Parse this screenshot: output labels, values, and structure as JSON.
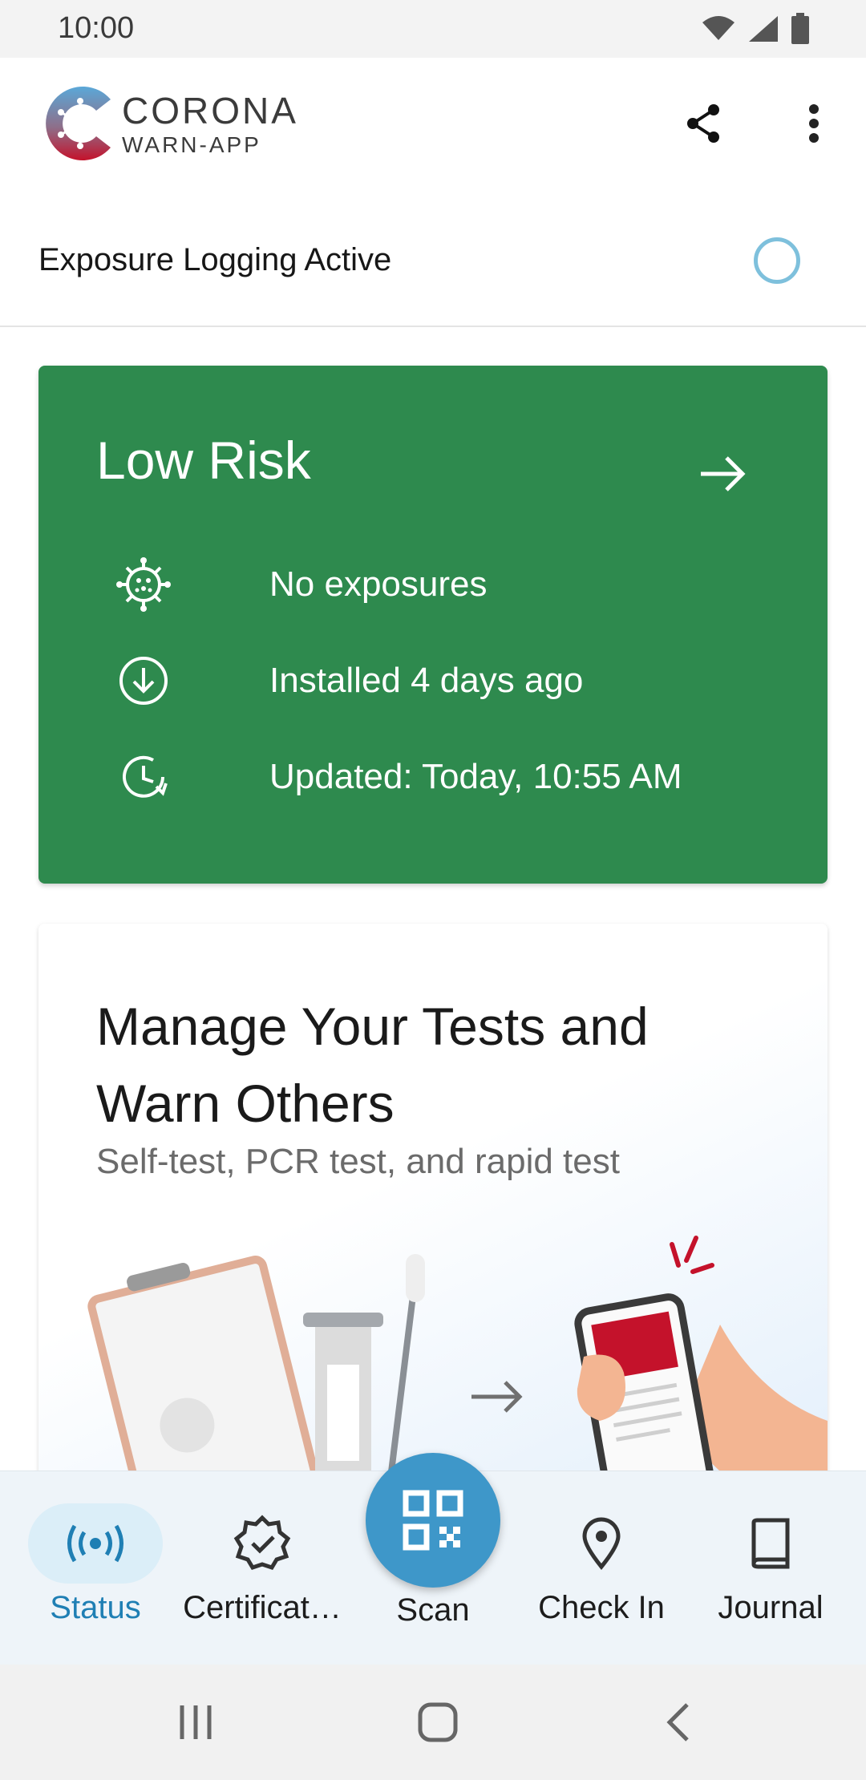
{
  "status_bar": {
    "time": "10:00"
  },
  "app": {
    "name_line1": "CORONA",
    "name_line2": "WARN-APP"
  },
  "exposure": {
    "label": "Exposure Logging Active"
  },
  "risk_card": {
    "title": "Low Risk",
    "rows": [
      {
        "icon": "virus-icon",
        "text": "No exposures"
      },
      {
        "icon": "download-icon",
        "text": "Installed 4 days ago"
      },
      {
        "icon": "refresh-clock-icon",
        "text": "Updated: Today, 10:55 AM"
      }
    ],
    "color": "#2e8a4e"
  },
  "tests_card": {
    "title": "Manage Your Tests and Warn Others",
    "subtitle": "Self-test, PCR test, and rapid test"
  },
  "bottom_nav": {
    "items": [
      {
        "label": "Status",
        "icon": "broadcast-icon",
        "active": true
      },
      {
        "label": "Certificat…",
        "icon": "certificate-badge-icon",
        "active": false
      },
      {
        "label": "Scan",
        "icon": "qr-code-icon",
        "active": false
      },
      {
        "label": "Check In",
        "icon": "location-pin-icon",
        "active": false
      },
      {
        "label": "Journal",
        "icon": "book-icon",
        "active": false
      }
    ],
    "accent": "#1f7fb4"
  }
}
